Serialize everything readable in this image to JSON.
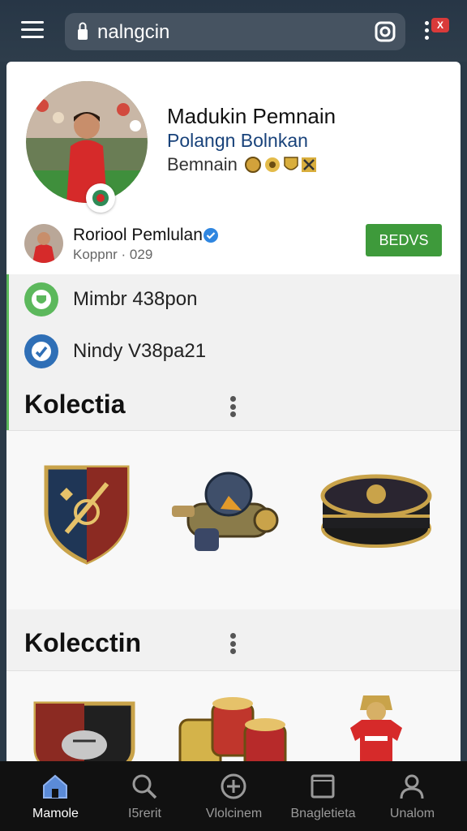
{
  "browser": {
    "url": "nalngcin",
    "badge": "X"
  },
  "profile": {
    "title": "Madukin Pemnain",
    "subtitle": "Polangn Bolnkan",
    "role": "Bemnain"
  },
  "user": {
    "name": "Roriool Pemlulan",
    "meta": "Koppnr · 029",
    "action_label": "BEDVS"
  },
  "stats": [
    {
      "label": "Mimbr 438pon",
      "icon": "badge-icon"
    },
    {
      "label": "Nindy V38pa21",
      "icon": "check-icon"
    }
  ],
  "collections": [
    {
      "title": "Kolectia",
      "items": [
        "crest-shield",
        "robot-cannon",
        "round-gold-chest"
      ]
    },
    {
      "title": "Kolecctin",
      "items": [
        "crest-shield-red",
        "treasure-barrels",
        "player-jersey"
      ]
    }
  ],
  "bottom_nav": [
    {
      "label": "Mamole",
      "icon": "home-icon",
      "active": true
    },
    {
      "label": "I5rerit",
      "icon": "search-icon",
      "active": false
    },
    {
      "label": "Vlolcinem",
      "icon": "plus-icon",
      "active": false
    },
    {
      "label": "Bnagletieta",
      "icon": "square-icon",
      "active": false
    },
    {
      "label": "Unalom",
      "icon": "user-icon",
      "active": false
    }
  ],
  "colors": {
    "topbar": "#2b3a48",
    "accent_green": "#3e9a3b",
    "link_blue": "#18427a"
  }
}
